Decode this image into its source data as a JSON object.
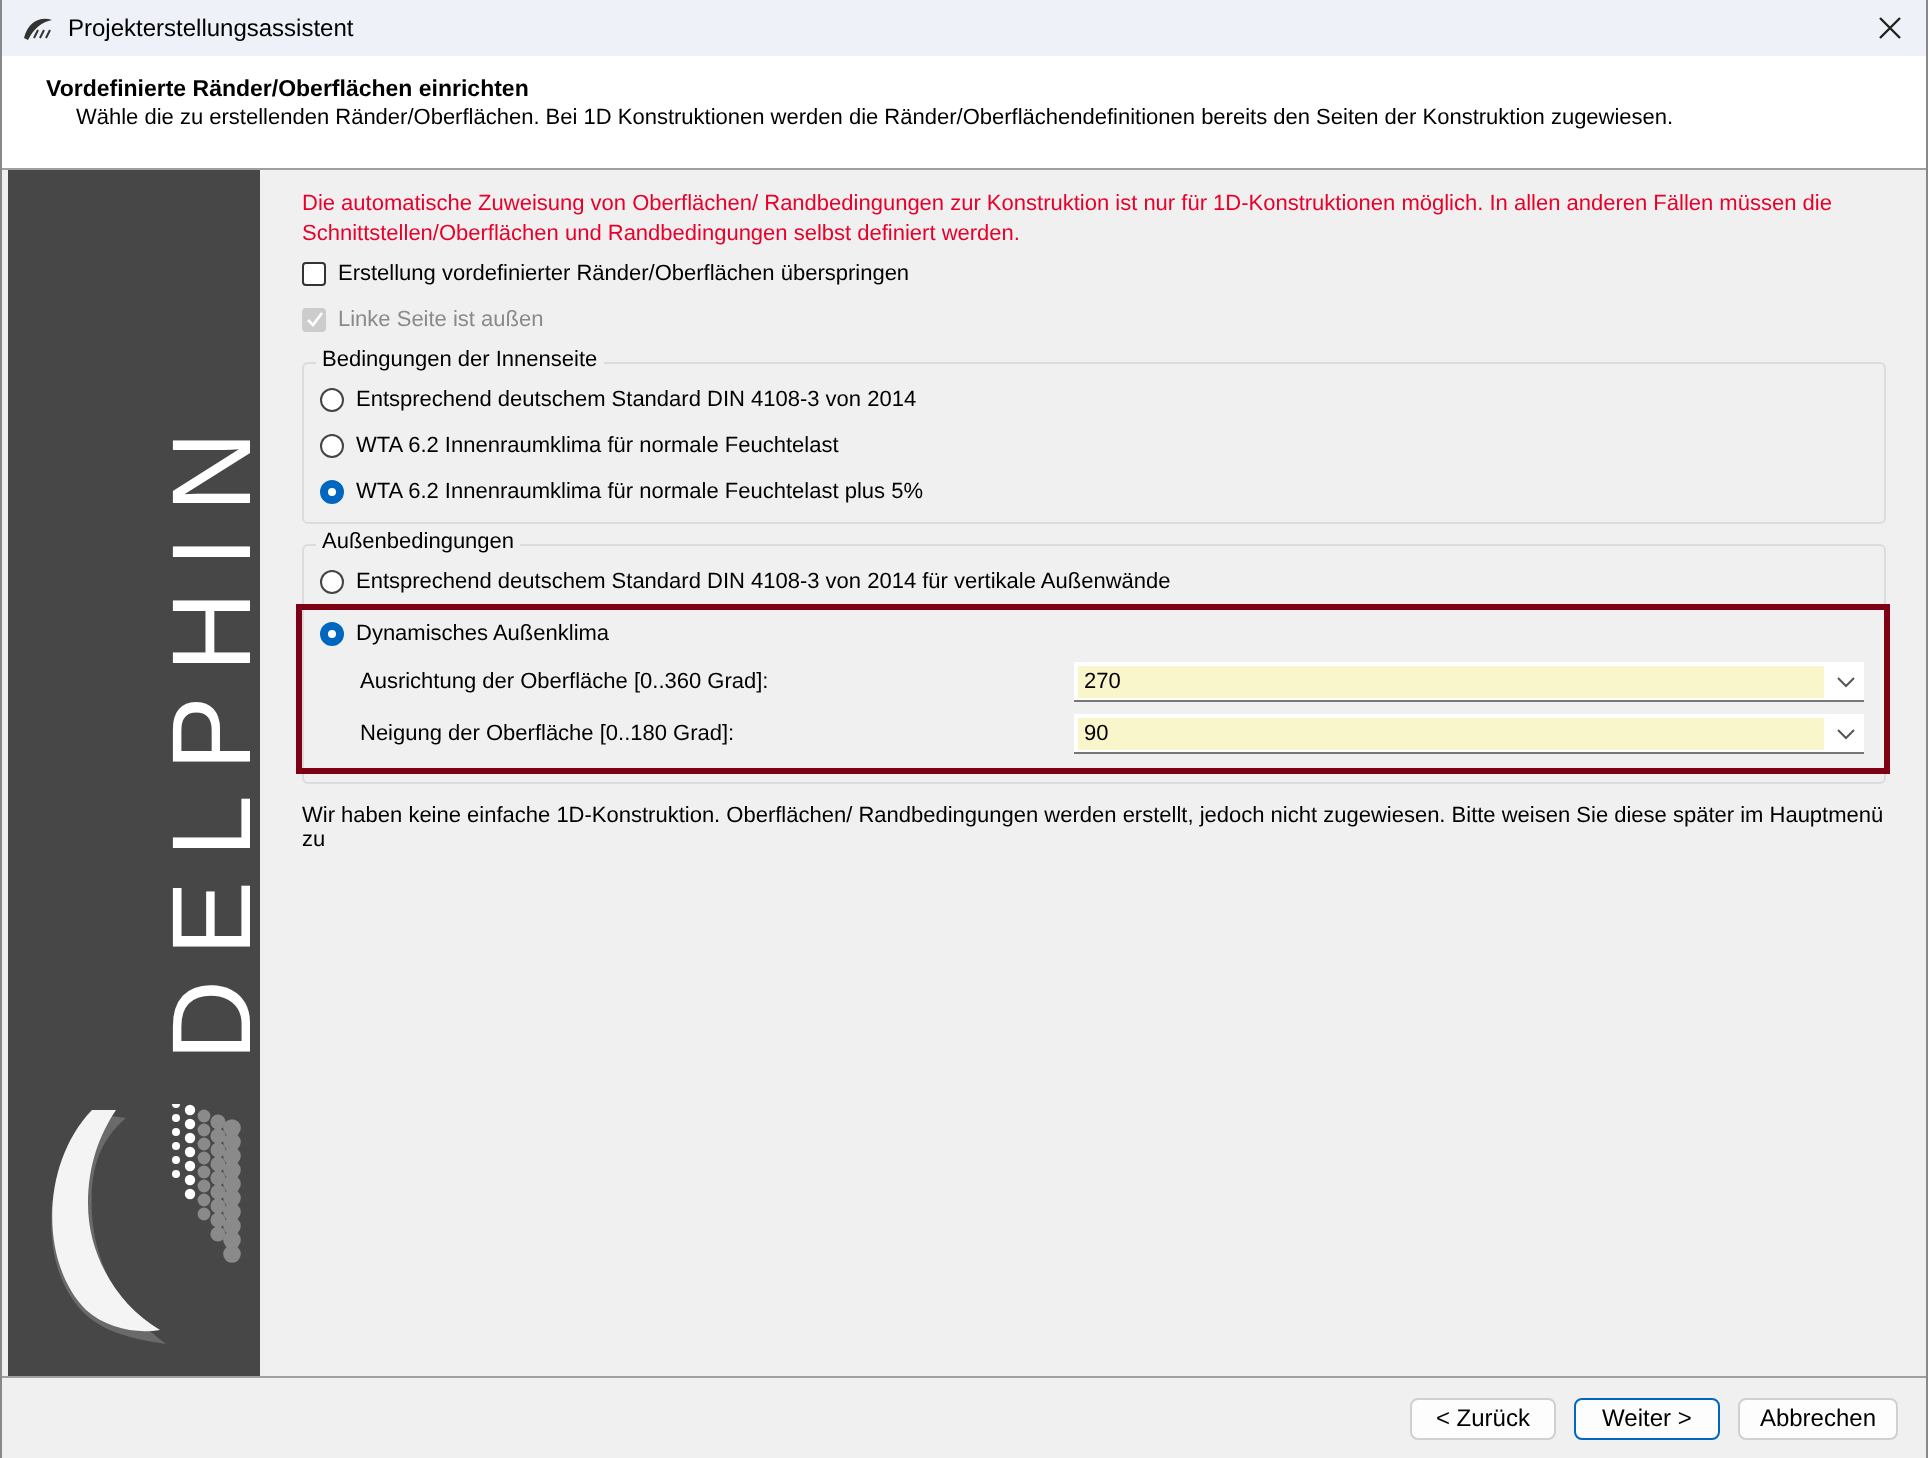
{
  "window": {
    "title": "Projekterstellungsassistent"
  },
  "header": {
    "title": "Vordefinierte Ränder/Oberflächen einrichten",
    "subtitle": "Wähle die zu erstellenden Ränder/Oberflächen. Bei 1D Konstruktionen werden die Ränder/Oberflächendefinitionen bereits den Seiten der Konstruktion zugewiesen."
  },
  "sidebar": {
    "logo_text": "DELPHIN"
  },
  "warning": "Die automatische Zuweisung von Oberflächen/ Randbedingungen zur Konstruktion ist nur für 1D-Konstruktionen möglich. In allen anderen Fällen müssen die Schnittstellen/Oberflächen und Randbedingungen selbst definiert werden.",
  "checkboxes": [
    {
      "label": "Erstellung vordefinierter Ränder/Oberflächen überspringen",
      "checked": false,
      "disabled": false
    },
    {
      "label": "Linke Seite ist außen",
      "checked": true,
      "disabled": true
    }
  ],
  "inner_group": {
    "title": "Bedingungen der Innenseite",
    "options": [
      {
        "label": "Entsprechend deutschem Standard DIN 4108-3 von 2014",
        "selected": false
      },
      {
        "label": "WTA 6.2 Innenraumklima für normale Feuchtelast",
        "selected": false
      },
      {
        "label": "WTA 6.2 Innenraumklima für normale Feuchtelast plus 5%",
        "selected": true
      }
    ]
  },
  "outer_group": {
    "title": "Außenbedingungen",
    "options": [
      {
        "label": "Entsprechend deutschem Standard DIN 4108-3 von 2014 für vertikale Außenwände",
        "selected": false
      },
      {
        "label": "Dynamisches Außenklima",
        "selected": true
      }
    ],
    "fields": [
      {
        "label": "Ausrichtung der Oberfläche [0..360 Grad]:",
        "value": "270"
      },
      {
        "label": "Neigung der Oberfläche [0..180 Grad]:",
        "value": "90"
      }
    ]
  },
  "info": "Wir haben keine einfache 1D-Konstruktion. Oberflächen/ Randbedingungen werden erstellt, jedoch nicht zugewiesen. Bitte weisen Sie diese später im Hauptmenü zu",
  "buttons": [
    {
      "label": "< Zurück",
      "default": false
    },
    {
      "label": "Weiter >",
      "default": true
    },
    {
      "label": "Abbrechen",
      "default": false
    }
  ]
}
